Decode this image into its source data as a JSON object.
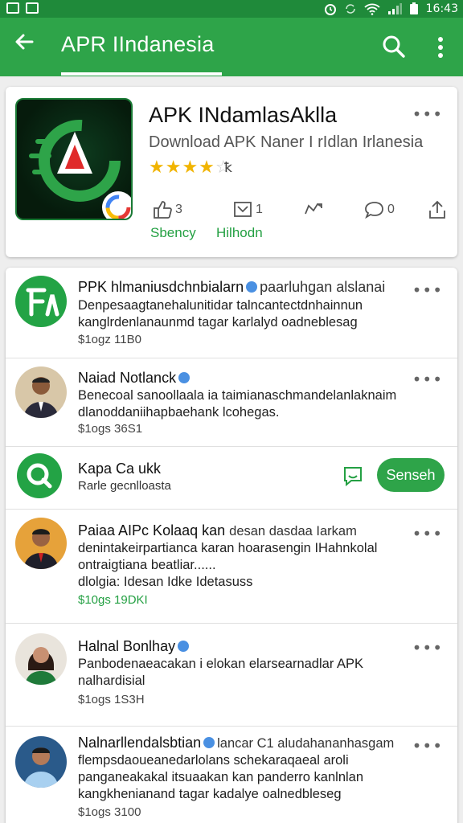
{
  "status_bar": {
    "time": "16:43"
  },
  "app_bar": {
    "title": "APR IIndanesia"
  },
  "app_card": {
    "name": "APK INdamlasAklla",
    "subtitle": "Download APK Naner I rIdlan Irlanesia",
    "rating_stars": 3.5,
    "rating_text": "ꝁ",
    "actions": [
      {
        "icon": "thumbs-up-icon",
        "count": "3",
        "label": "Sbency"
      },
      {
        "icon": "download-icon",
        "count": "1",
        "label": "Hilhodn"
      },
      {
        "icon": "repost-icon",
        "count": "",
        "label": ""
      },
      {
        "icon": "comment-icon",
        "count": "0",
        "label": ""
      },
      {
        "icon": "share-icon",
        "count": "",
        "label": ""
      }
    ]
  },
  "posts": [
    {
      "name": "PPK hlmaniusdchnbialarn",
      "handle": "paarluhgan alslanai",
      "line1": "Denpesaagtanehalunitidar talncantectdnhainnun",
      "line2": "kanglrdenlanaunmd tagar karlalyd oadneblesag",
      "meta": "$1ogz   11B0"
    },
    {
      "name": "Naiad Notlanck",
      "handle": "",
      "line1": "Benecoal sanoollaala ia taimianaschmandelanlaknaim",
      "line2": "dlanoddaniihapbaehank lcohegas.",
      "meta": "$1ogs   36S1"
    },
    {
      "name": "Kapa Ca ukk",
      "sub": "Rarle gecnlloasta",
      "button": "Senseh"
    },
    {
      "name": "Paiaa AIPc Kolaaq kan",
      "handle": "desan dasdaa Iarkam",
      "line1": "denintakeirpartianca karan hoarasengin IHahnkolal",
      "line2": "ontraigtiana beatliar......",
      "line3": "dlolgia: Idesan    Idke Idetasuss",
      "meta": "$10gs   19DKI"
    },
    {
      "name": "Halnal Bonlhay",
      "handle": "",
      "line1": "Panbodenaeacakan i elokan elarsearnadlar APK",
      "line2": "nalhardisial",
      "meta": "$1ogs   1S3H"
    },
    {
      "name": "Nalnarllendalsbtian",
      "handle": "lancar  C1 aludahananhasgam",
      "line1": "flempsdaoueanedarlolans schekaraqaeal aroli",
      "line2": "panganeakakal itsuaakan kan panderro kanlnlan",
      "line3": "kangkhenianand tagar kadalye oalnedbleseg",
      "meta": "$1ogs   3100"
    }
  ],
  "colors": {
    "brand_green": "#2ea449",
    "status_green": "#1f8a3a",
    "accent_link": "#24a043"
  }
}
